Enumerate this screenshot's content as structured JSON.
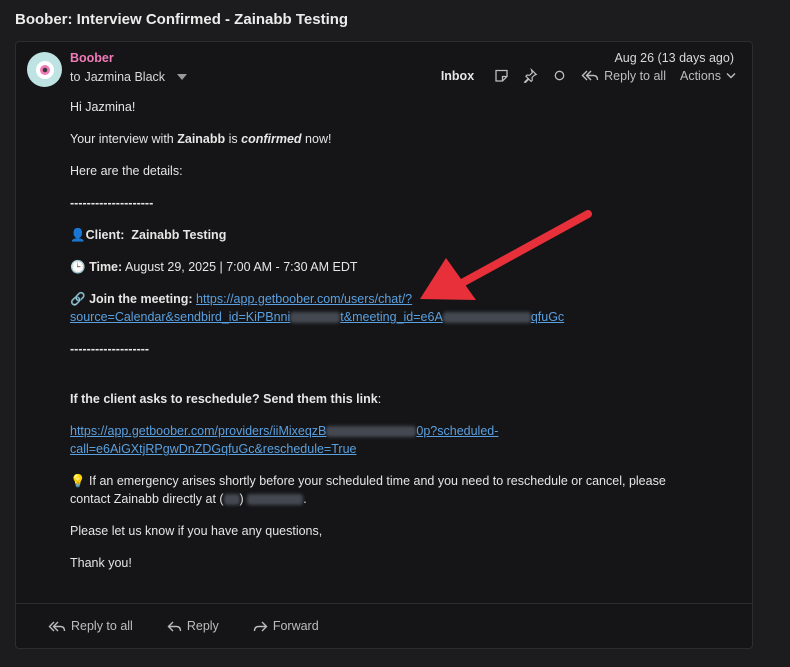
{
  "subject": "Boober: Interview Confirmed - Zainabb Testing",
  "header": {
    "sender": "Boober",
    "recipient_prefix": "to",
    "recipient": "Jazmina Black",
    "date": "Aug 26 (13 days ago)"
  },
  "toolbar": {
    "inbox": "Inbox",
    "reply_all": "Reply to all",
    "actions": "Actions"
  },
  "body": {
    "greeting": "Hi Jazmina!",
    "confirm_prefix": "Your interview with ",
    "confirm_name": "Zainabb",
    "confirm_mid": " is ",
    "confirm_word": "confirmed",
    "confirm_suffix": " now!",
    "details_intro": "Here are the details:",
    "separator1": "--------------------",
    "client_icon": "👤",
    "client_label": "Client:",
    "client_value": "Zainabb Testing",
    "time_icon": "🕒",
    "time_label": "Time:",
    "time_value": "August 29, 2025 | 7:00 AM - 7:30 AM EDT",
    "meeting_icon": "🔗",
    "meeting_label": "Join the meeting:",
    "meeting_link_1a": "https://app.getboober.com/users/chat/?",
    "meeting_link_2a": "source=Calendar&sendbird_id=KiPBnni",
    "meeting_link_2b": "t&meeting_id=e6A",
    "meeting_link_2c": "qfuGc",
    "separator2": "-------------------",
    "reschedule_q": "If the client asks to reschedule? Send them this link",
    "reschedule_colon": ":",
    "resched_link_1a": "https://app.getboober.com/providers/iiMixeqzB",
    "resched_link_1b": "0p?scheduled-",
    "resched_link_2": "call=e6AiGXtjRPgwDnZDGqfuGc&reschedule=True",
    "emergency_icon": "💡",
    "emergency_1": " If an emergency arises shortly before your scheduled time and you need to reschedule or cancel, please",
    "emergency_2a": "contact Zainabb directly at (",
    "emergency_2b": ") ",
    "emergency_2c": ".",
    "questions": "Please let us know if you have any questions,",
    "thanks": "Thank you!"
  },
  "footer": {
    "reply_all": "Reply to all",
    "reply": "Reply",
    "forward": "Forward"
  },
  "colors": {
    "sender": "#f07ab7",
    "link": "#5aa0e0",
    "annotation_arrow": "#e8303a"
  }
}
